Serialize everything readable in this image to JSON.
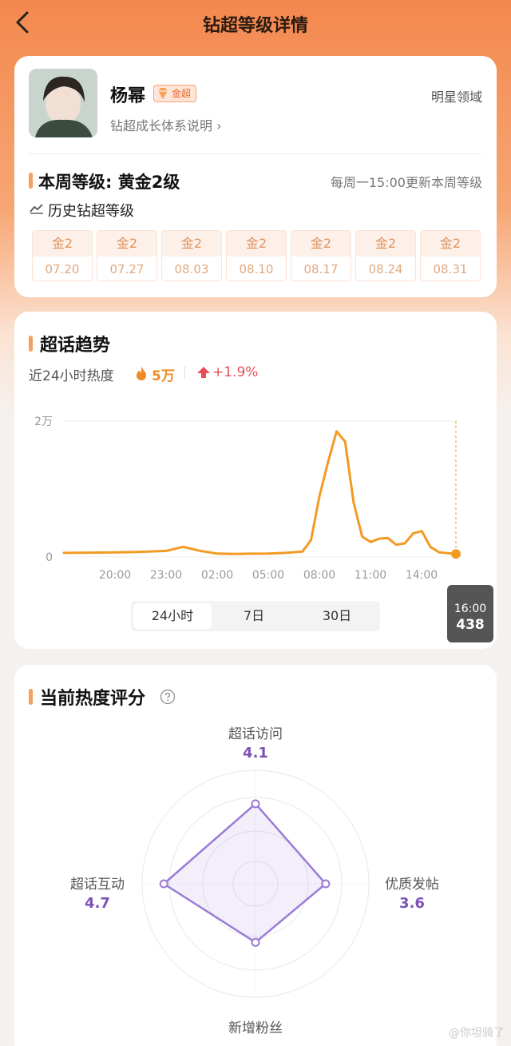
{
  "header": {
    "title": "钻超等级详情",
    "back_icon": "chevron-left-icon"
  },
  "profile": {
    "name": "杨幂",
    "badge": "金超",
    "growth_link": "钻超成长体系说明 ›",
    "domain": "明星领域"
  },
  "level": {
    "weekly_level": "本周等级: 黄金2级",
    "update_note": "每周一15:00更新本周等级",
    "history_title": "历史钻超等级",
    "history": [
      {
        "level": "金2",
        "date": "07.20"
      },
      {
        "level": "金2",
        "date": "07.27"
      },
      {
        "level": "金2",
        "date": "08.03"
      },
      {
        "level": "金2",
        "date": "08.10"
      },
      {
        "level": "金2",
        "date": "08.17"
      },
      {
        "level": "金2",
        "date": "08.24"
      },
      {
        "level": "金2",
        "date": "08.31"
      }
    ]
  },
  "trend": {
    "title": "超话趋势",
    "heat_label": "近24小时热度",
    "heat_value": "5万",
    "heat_change": "+1.9%",
    "tabs": [
      "24小时",
      "7日",
      "30日"
    ],
    "active_tab": "24小时",
    "tooltip": {
      "time": "16:00",
      "value": "438"
    }
  },
  "chart_data": {
    "type": "line",
    "x_ticks": [
      "20:00",
      "23:00",
      "02:00",
      "05:00",
      "08:00",
      "11:00",
      "14:00"
    ],
    "y_ticks": [
      "2万",
      "0"
    ],
    "ylim": [
      0,
      20000
    ],
    "series": [
      {
        "x": [
          17.0,
          18.0,
          19.0,
          20.0,
          21.0,
          22.0,
          23.0,
          24.0,
          25.0,
          26.0,
          27.0,
          28.0,
          29.0,
          30.0,
          31.0,
          31.5,
          32.0,
          32.5,
          33.0,
          33.5,
          34.0,
          34.5,
          35.0,
          35.5,
          36.0,
          36.5,
          37.0,
          37.5,
          38.0,
          38.5,
          39.0,
          39.5,
          40.0
        ],
        "y": [
          600,
          620,
          650,
          680,
          720,
          800,
          900,
          1500,
          900,
          500,
          450,
          480,
          500,
          600,
          800,
          2500,
          9000,
          14000,
          18500,
          17000,
          8000,
          3000,
          2200,
          2700,
          2800,
          1800,
          2000,
          3500,
          3800,
          1500,
          700,
          550,
          438
        ],
        "color": "#f39a24"
      }
    ],
    "grid": true
  },
  "score": {
    "title": "当前热度评分",
    "help_icon": "question-circle-icon"
  },
  "radar_data": {
    "type": "radar",
    "max": 5,
    "axes": [
      {
        "label": "超话访问",
        "value": 4.1
      },
      {
        "label": "优质发帖",
        "value": 3.6
      },
      {
        "label": "新增粉丝",
        "value": 3.0
      },
      {
        "label": "超话互动",
        "value": 4.7
      }
    ],
    "color": "#9b7ad8"
  },
  "watermark": "@你坦骑了",
  "colors": {
    "accent": "#f5a05e",
    "heat": "#f08a24",
    "up": "#e94d5c",
    "radar": "#7b52b8"
  }
}
